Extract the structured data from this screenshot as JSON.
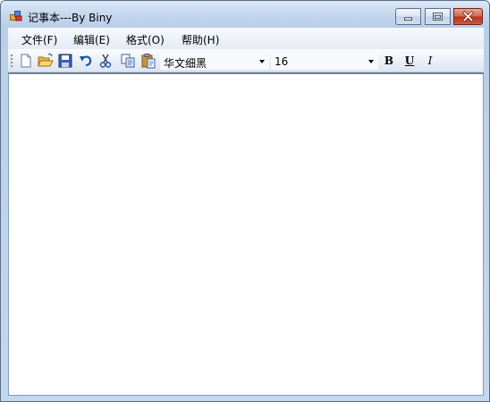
{
  "window": {
    "title": "记事本---By Biny",
    "controls": {
      "minimize_icon": "minimize-icon",
      "maximize_icon": "maximize-icon",
      "close_icon": "close-icon"
    }
  },
  "menubar": {
    "items": [
      {
        "label": "文件(F)"
      },
      {
        "label": "编辑(E)"
      },
      {
        "label": "格式(O)"
      },
      {
        "label": "帮助(H)"
      }
    ]
  },
  "toolbar": {
    "buttons": [
      {
        "icon": "new-file-icon"
      },
      {
        "icon": "open-folder-icon"
      },
      {
        "icon": "save-icon"
      },
      {
        "icon": "undo-icon"
      },
      {
        "icon": "cut-icon"
      },
      {
        "icon": "copy-icon"
      },
      {
        "icon": "paste-icon"
      }
    ],
    "font_family": "华文细黑",
    "font_size": "16",
    "bold_label": "B",
    "underline_label": "U",
    "italic_label": "I"
  },
  "editor": {
    "content": ""
  },
  "colors": {
    "titlebar": "#c5d8ef",
    "close_button": "#c9452b",
    "editor_background": "#ffffff"
  }
}
